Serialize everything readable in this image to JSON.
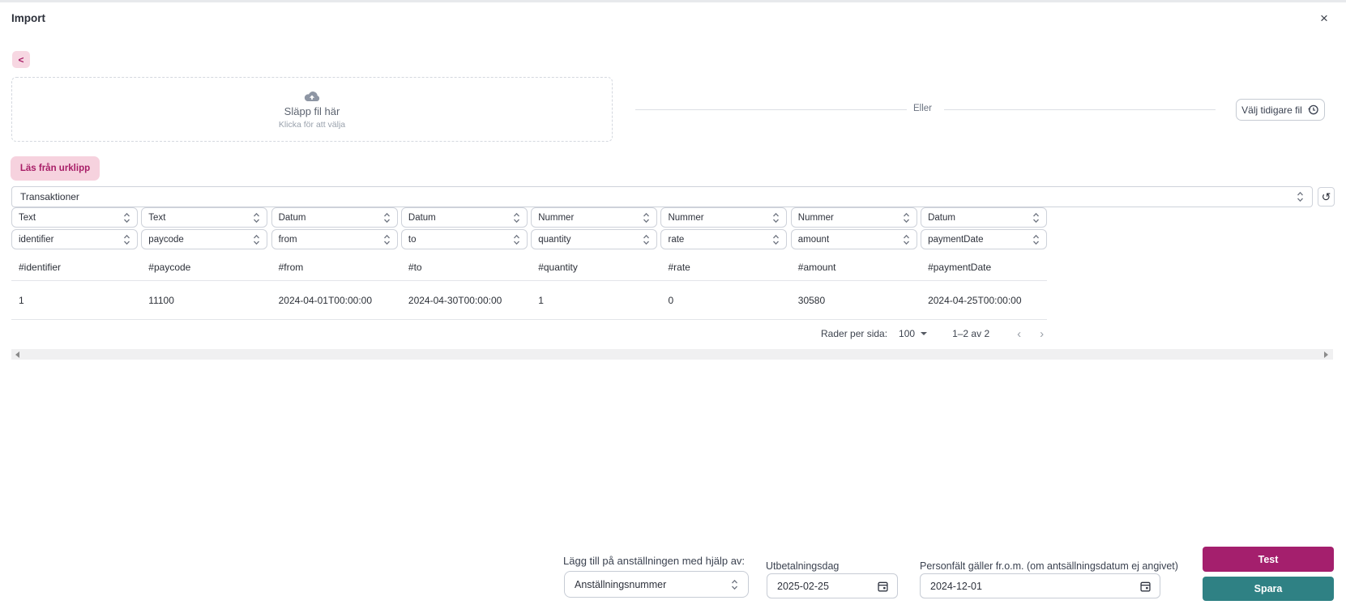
{
  "dialog": {
    "title": "Import"
  },
  "icons": {
    "close": "×",
    "back": "<",
    "reset": "↺",
    "prev_page": "‹",
    "next_page": "›",
    "cloud_upload": "cloud-upload-icon",
    "history": "history-icon",
    "calendar": "calendar-icon",
    "select_chevrons": "chevron-up-down-icon"
  },
  "dropzone": {
    "title": "Släpp fil här",
    "subtitle": "Klicka för att välja"
  },
  "divider": {
    "label": "Eller"
  },
  "previous_file_button": {
    "label": "Välj tidigare fil"
  },
  "clipboard_button": {
    "label": "Läs från urklipp"
  },
  "import_type_select": {
    "value": "Transaktioner"
  },
  "mapping": {
    "types": [
      "Text",
      "Text",
      "Datum",
      "Datum",
      "Nummer",
      "Nummer",
      "Nummer",
      "Datum"
    ],
    "fields": [
      "identifier",
      "paycode",
      "from",
      "to",
      "quantity",
      "rate",
      "amount",
      "paymentDate"
    ]
  },
  "table": {
    "headers": [
      "#identifier",
      "#paycode",
      "#from",
      "#to",
      "#quantity",
      "#rate",
      "#amount",
      "#paymentDate"
    ],
    "rows": [
      [
        "1",
        "11100",
        "2024-04-01T00:00:00",
        "2024-04-30T00:00:00",
        "1",
        "0",
        "30580",
        "2024-04-25T00:00:00"
      ]
    ]
  },
  "pagination": {
    "rows_per_page_label": "Rader per sida:",
    "rows_per_page_value": "100",
    "range_label": "1–2 av 2"
  },
  "footer": {
    "match_label": "Lägg till på anställningen med hjälp av:",
    "match_value": "Anställningsnummer",
    "payment_date_label": "Utbetalningsdag",
    "payment_date_value": "2025-02-25",
    "person_field_label": "Personfält gäller fr.o.m. (om antsällningsdatum ej angivet)",
    "person_field_value": "2024-12-01",
    "test_label": "Test",
    "save_label": "Spara"
  },
  "colors": {
    "magenta": "#a41f6d",
    "pink": "#f6d2de",
    "teal": "#2f8184"
  }
}
